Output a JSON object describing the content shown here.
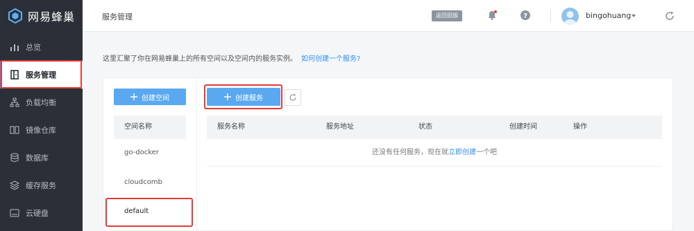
{
  "brand": {
    "name": "网易蜂巢"
  },
  "sidebar": {
    "items": [
      {
        "label": "总览",
        "icon": "bar-chart-icon"
      },
      {
        "label": "服务管理",
        "icon": "service-door-icon",
        "active": true
      },
      {
        "label": "负载均衡",
        "icon": "load-balance-icon"
      },
      {
        "label": "镜像仓库",
        "icon": "image-repo-icon"
      },
      {
        "label": "数据库",
        "icon": "database-icon"
      },
      {
        "label": "缓存服务",
        "icon": "cache-layers-icon"
      },
      {
        "label": "云硬盘",
        "icon": "cloud-disk-icon"
      }
    ]
  },
  "topbar": {
    "title": "服务管理",
    "old_version_label": "返回旧版",
    "username": "bingohuang"
  },
  "intro": {
    "text": "这里汇聚了你在网易蜂巢上的所有空间以及空间内的服务实例。",
    "link": "如何创建一个服务?"
  },
  "spaces": {
    "create_label": "创建空间",
    "header": "空间名称",
    "items": [
      "go-docker",
      "cloudcomb",
      "default"
    ]
  },
  "services": {
    "create_label": "创建服务",
    "columns": [
      "服务名称",
      "服务地址",
      "状态",
      "创建时间",
      "操作"
    ],
    "empty_prefix": "还没有任何服务，现在就",
    "empty_link": "立即创建",
    "empty_suffix": "一个吧"
  },
  "colors": {
    "sidebar_bg": "#2b3038",
    "accent": "#2f8ff0",
    "primary_button": "#5aa8f0",
    "highlight": "#e53935"
  }
}
